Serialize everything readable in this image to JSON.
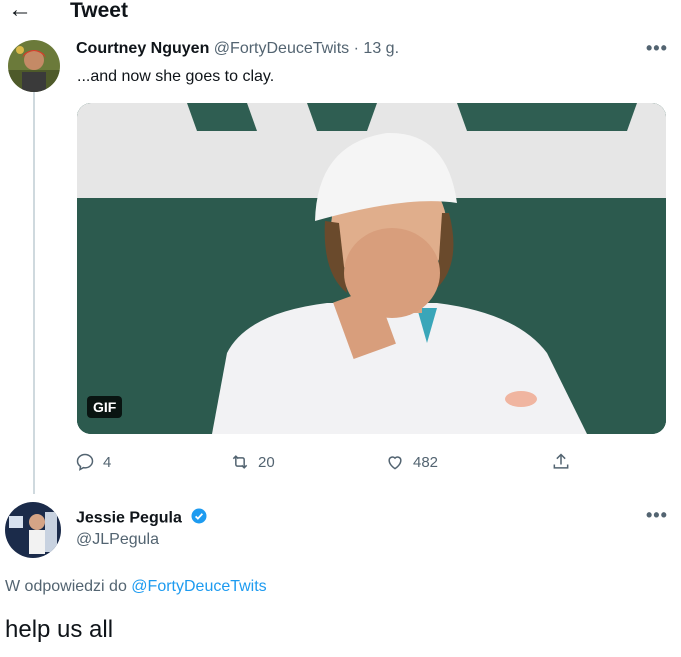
{
  "header": {
    "title": "Tweet",
    "back_icon": "arrow-left-icon"
  },
  "tweet": {
    "author_name": "Courtney Nguyen",
    "handle": "@FortyDeuceTwits",
    "separator": "·",
    "time": "13 g.",
    "text": "...and now she goes to clay.",
    "media_badge": "GIF",
    "actions": {
      "replies": "4",
      "retweets": "20",
      "likes": "482"
    }
  },
  "reply": {
    "author_name": "Jessie Pegula",
    "handle": "@JLPegula",
    "replying_to_prefix": "W odpowiedzi do",
    "replying_to_handle": "@FortyDeuceTwits",
    "text": "help us all"
  },
  "colors": {
    "accent": "#1d9bf0",
    "secondary_text": "#536471",
    "border": "#cfd9de"
  }
}
